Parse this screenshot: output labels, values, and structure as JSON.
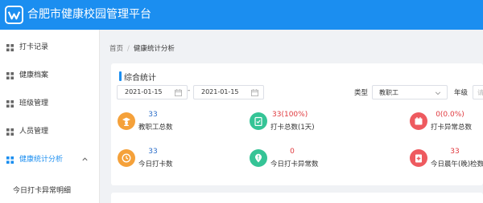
{
  "app": {
    "title": "合肥市健康校园管理平台"
  },
  "sidebar": {
    "items": [
      {
        "label": "打卡记录"
      },
      {
        "label": "健康档案"
      },
      {
        "label": "班级管理"
      },
      {
        "label": "人员管理"
      },
      {
        "label": "健康统计分析"
      }
    ],
    "sub_items": [
      {
        "label": "今日打卡异常明细"
      }
    ]
  },
  "breadcrumb": {
    "home": "首页",
    "separator": "/",
    "current": "健康统计分析"
  },
  "section": {
    "title": "综合统计"
  },
  "filters": {
    "start_date": "2021-01-15",
    "date_separator": "-",
    "end_date": "2021-01-15",
    "type_label": "类型",
    "type_value": "教职工",
    "grade_label": "年级",
    "grade_placeholder": "请"
  },
  "stats": [
    {
      "value": "33",
      "label": "教职工总数",
      "color": "#f5a13a",
      "value_color": "#2c6ec9",
      "icon": "teacher-icon"
    },
    {
      "value": "33(100%)",
      "label": "打卡总数(1天)",
      "color": "#35c496",
      "value_color": "#e0393e",
      "icon": "clipboard-check-icon"
    },
    {
      "value": "0(0.0%)",
      "label": "打卡异常总数",
      "color": "#ee5a5f",
      "value_color": "#e0393e",
      "icon": "calendar-alert-icon"
    },
    {
      "value": "33",
      "label": "今日打卡数",
      "color": "#f5a13a",
      "value_color": "#2c6ec9",
      "icon": "clock-icon"
    },
    {
      "value": "0",
      "label": "今日打卡异常数",
      "color": "#35c496",
      "value_color": "#e0393e",
      "icon": "location-alert-icon"
    },
    {
      "value": "33",
      "label": "今日晨午(晚)检数",
      "color": "#ee5a5f",
      "value_color": "#e0393e",
      "icon": "medical-check-icon"
    }
  ],
  "colors": {
    "brand": "#1b8ef0",
    "active": "#1b8ef0"
  }
}
